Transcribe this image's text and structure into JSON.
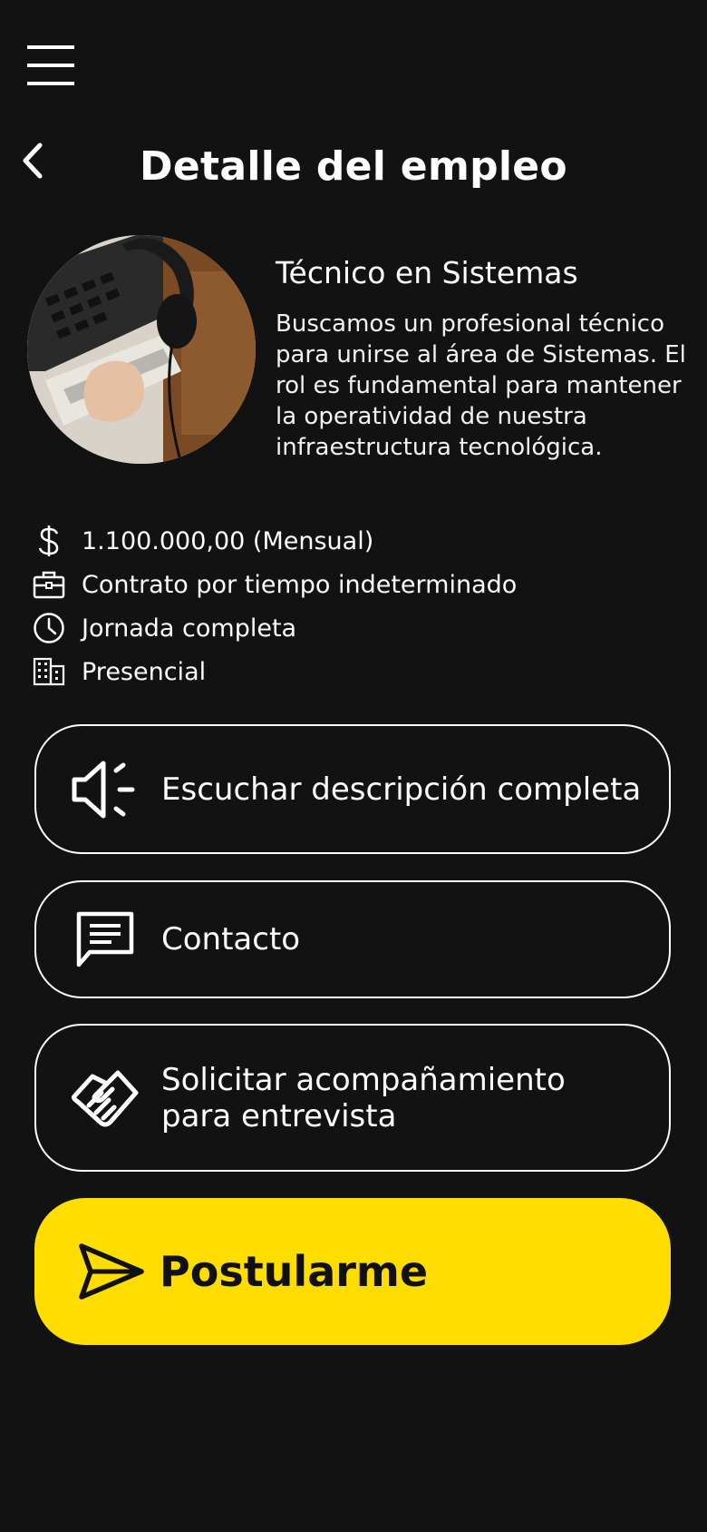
{
  "header": {
    "title": "Detalle del empleo"
  },
  "job": {
    "title": "Técnico en Sistemas",
    "description": "Buscamos un profesional técnico para unirse al área de Sistemas. El rol es fundamental para mantener la operatividad de nuestra infraestructura tecnológica."
  },
  "details": [
    {
      "icon": "dollar-icon",
      "text": "1.100.000,00 (Mensual)"
    },
    {
      "icon": "briefcase-icon",
      "text": "Contrato por tiempo indeterminado"
    },
    {
      "icon": "clock-icon",
      "text": "Jornada completa"
    },
    {
      "icon": "building-icon",
      "text": "Presencial"
    }
  ],
  "actions": {
    "listen": {
      "icon": "speaker-icon",
      "label": "Escuchar descripción completa"
    },
    "contact": {
      "icon": "chat-icon",
      "label": "Contacto"
    },
    "support": {
      "icon": "handshake-icon",
      "label_line1": "Solicitar acompañamiento",
      "label_line2": "para entrevista"
    }
  },
  "apply": {
    "icon": "send-icon",
    "label": "Postularme"
  },
  "colors": {
    "background": "#121212",
    "accent": "#ffdd00",
    "text": "#ffffff"
  }
}
